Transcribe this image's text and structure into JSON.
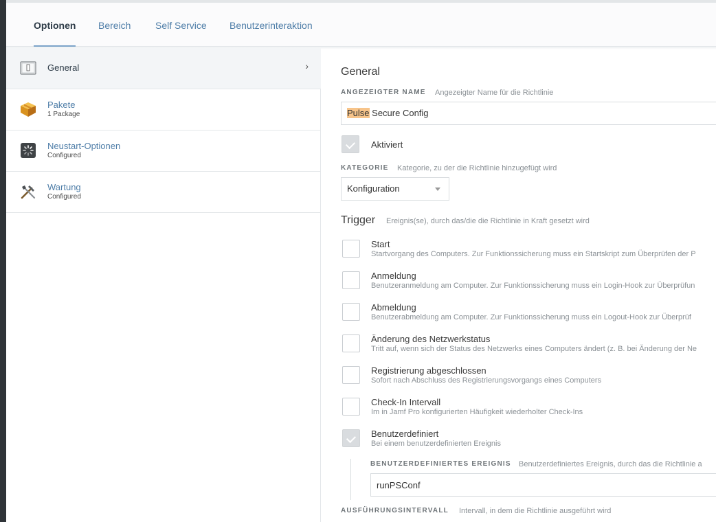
{
  "tabs": [
    {
      "label": "Optionen",
      "active": true
    },
    {
      "label": "Bereich"
    },
    {
      "label": "Self Service"
    },
    {
      "label": "Benutzerinteraktion"
    }
  ],
  "sidebar": {
    "items": [
      {
        "title": "General",
        "subtitle": "",
        "icon": "switch-icon"
      },
      {
        "title": "Pakete",
        "subtitle": "1 Package",
        "icon": "package-icon"
      },
      {
        "title": "Neustart-Optionen",
        "subtitle": "Configured",
        "icon": "restart-icon"
      },
      {
        "title": "Wartung",
        "subtitle": "Configured",
        "icon": "tools-icon"
      }
    ]
  },
  "main": {
    "section_title": "General",
    "display_name": {
      "label": "ANGEZEIGTER NAME",
      "hint": "Angezeigter Name für die Richtlinie",
      "value_highlight": "Pulse",
      "value_rest": " Secure Config"
    },
    "enabled": {
      "label": "Aktiviert",
      "checked": true
    },
    "category": {
      "label": "KATEGORIE",
      "hint": "Kategorie, zu der die Richtlinie hinzugefügt wird",
      "selected": "Konfiguration"
    },
    "trigger": {
      "title": "Trigger",
      "hint": "Ereignis(se), durch das/die die Richtlinie in Kraft gesetzt wird",
      "items": [
        {
          "title": "Start",
          "desc": "Startvorgang des Computers. Zur Funktionssicherung muss ein Startskript zum Überprüfen der P",
          "checked": false
        },
        {
          "title": "Anmeldung",
          "desc": "Benutzeranmeldung am Computer. Zur Funktionssicherung muss ein Login-Hook zur Überprüfun",
          "checked": false
        },
        {
          "title": "Abmeldung",
          "desc": "Benutzerabmeldung am Computer. Zur Funktionssicherung muss ein Logout-Hook zur Überprüf",
          "checked": false
        },
        {
          "title": "Änderung des Netzwerkstatus",
          "desc": "Tritt auf, wenn sich der Status des Netzwerks eines Computers ändert (z. B. bei Änderung der Ne",
          "checked": false
        },
        {
          "title": "Registrierung abgeschlossen",
          "desc": "Sofort nach Abschluss des Registrierungsvorgangs eines Computers",
          "checked": false
        },
        {
          "title": "Check-In Intervall",
          "desc": "Im in Jamf Pro konfigurierten Häufigkeit wiederholter Check-Ins",
          "checked": false
        },
        {
          "title": "Benutzerdefiniert",
          "desc": "Bei einem benutzerdefinierten Ereignis",
          "checked": true
        }
      ]
    },
    "custom_event": {
      "label": "BENUTZERDEFINIERTES EREIGNIS",
      "hint": "Benutzerdefiniertes Ereignis, durch das die Richtlinie a",
      "value": "runPSConf"
    },
    "frequency": {
      "label": "AUSFÜHRUNGSINTERVALL",
      "hint": "Intervall, in dem die Richtlinie ausgeführt wird"
    }
  }
}
